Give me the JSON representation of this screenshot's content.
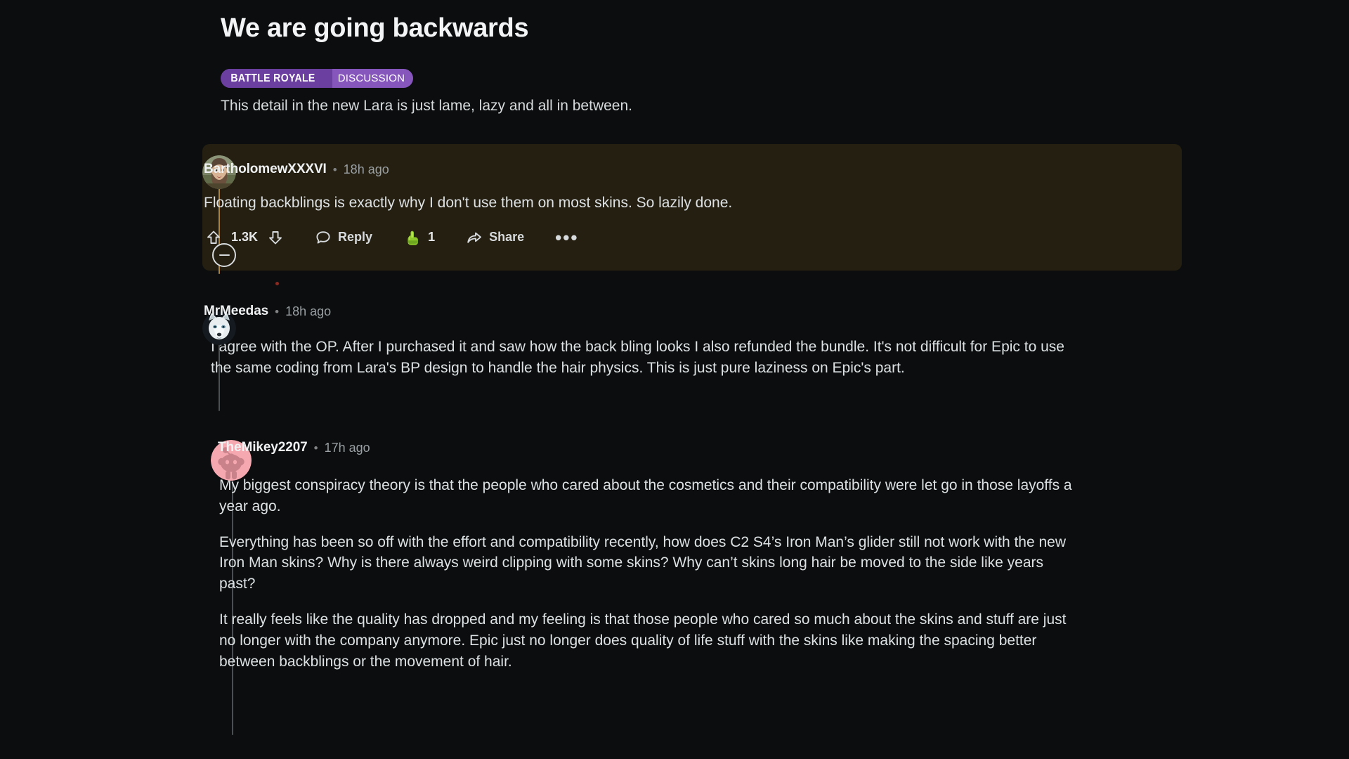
{
  "post": {
    "title": "We are going backwards",
    "flair_primary": "BATTLE ROYALE",
    "flair_secondary": "DISCUSSION",
    "flair_primary_color": "#6b3fa0",
    "flair_secondary_color": "#8656bd",
    "subtitle": "This detail in the new Lara is just lame, lazy and all in between."
  },
  "separator": "•",
  "comments": [
    {
      "author": "BartholomewXXXVI",
      "timestamp": "18h ago",
      "avatar": "bearded-man-photo-avatar",
      "highlighted": true,
      "thread_color": "#a8813f",
      "paragraphs": [
        "Floating backblings is exactly why I don't use them on most skins. So lazily done."
      ],
      "actions": {
        "collapse_icon": "collapse-minus-icon",
        "upvote_icon": "upvote-arrow-icon",
        "vote_count": "1.3K",
        "downvote_icon": "downvote-arrow-icon",
        "reply_icon": "comment-bubble-icon",
        "reply_label": "Reply",
        "award_icon": "green-pointing-hand-award-icon",
        "award_count": "1",
        "share_icon": "share-arrow-icon",
        "share_label": "Share",
        "overflow_label": "•••"
      }
    },
    {
      "author": "MrMeedas",
      "timestamp": "18h ago",
      "avatar": "white-wolf-photo-avatar",
      "highlighted": false,
      "thread_color": "#4a4f52",
      "paragraphs": [
        "I agree with the OP. After I purchased it and saw how the back bling looks I also refunded the bundle. It's not difficult for Epic to use the same coding from Lara's BP design to handle the hair physics. This is just pure laziness on Epic's part."
      ]
    },
    {
      "author": "TheMikey2207",
      "timestamp": "17h ago",
      "avatar": "pink-snoo-default-avatar",
      "highlighted": false,
      "thread_color": "#4a4f52",
      "paragraphs": [
        "My biggest conspiracy theory is that the people who cared about the cosmetics and their compatibility were let go in those layoffs a year ago.",
        "Everything has been so off with the effort and compatibility recently, how does C2 S4’s Iron Man’s glider still not work with the new Iron Man skins? Why is there always weird clipping with some skins? Why can’t skins long hair be moved to the side like years past?",
        "It really feels like the quality has dropped and my feeling is that those people who cared so much about the skins and stuff are just no longer with the company anymore. Epic just no longer does quality of life stuff with the skins like making the spacing better between backblings or the movement of hair."
      ]
    }
  ]
}
